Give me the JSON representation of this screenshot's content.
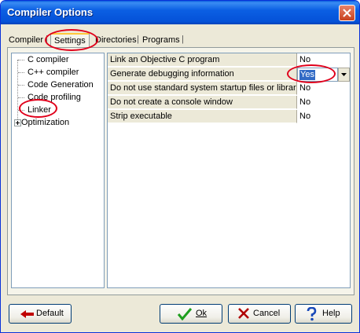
{
  "window": {
    "title": "Compiler Options"
  },
  "tabs": [
    {
      "label": "Compiler"
    },
    {
      "label": "Settings"
    },
    {
      "label": "Directories"
    },
    {
      "label": "Programs"
    }
  ],
  "tree": {
    "items": [
      {
        "label": "C compiler"
      },
      {
        "label": "C++ compiler"
      },
      {
        "label": "Code Generation"
      },
      {
        "label": "Code profiling"
      },
      {
        "label": "Linker"
      },
      {
        "label": "Optimization"
      }
    ],
    "selected": "Linker"
  },
  "settings": {
    "rows": [
      {
        "name": "Link an Objective C program",
        "value": "No"
      },
      {
        "name": "Generate debugging information",
        "value": "Yes"
      },
      {
        "name": "Do not use standard system startup files or libraries",
        "value": "No"
      },
      {
        "name": "Do not create a console window",
        "value": "No"
      },
      {
        "name": "Strip executable",
        "value": "No"
      }
    ]
  },
  "buttons": {
    "default": "Default",
    "ok": "Ok",
    "cancel": "Cancel",
    "help": "Help"
  },
  "colors": {
    "titlebar": "#0552d8",
    "annotation": "#e0001b",
    "selection": "#316ac5"
  }
}
